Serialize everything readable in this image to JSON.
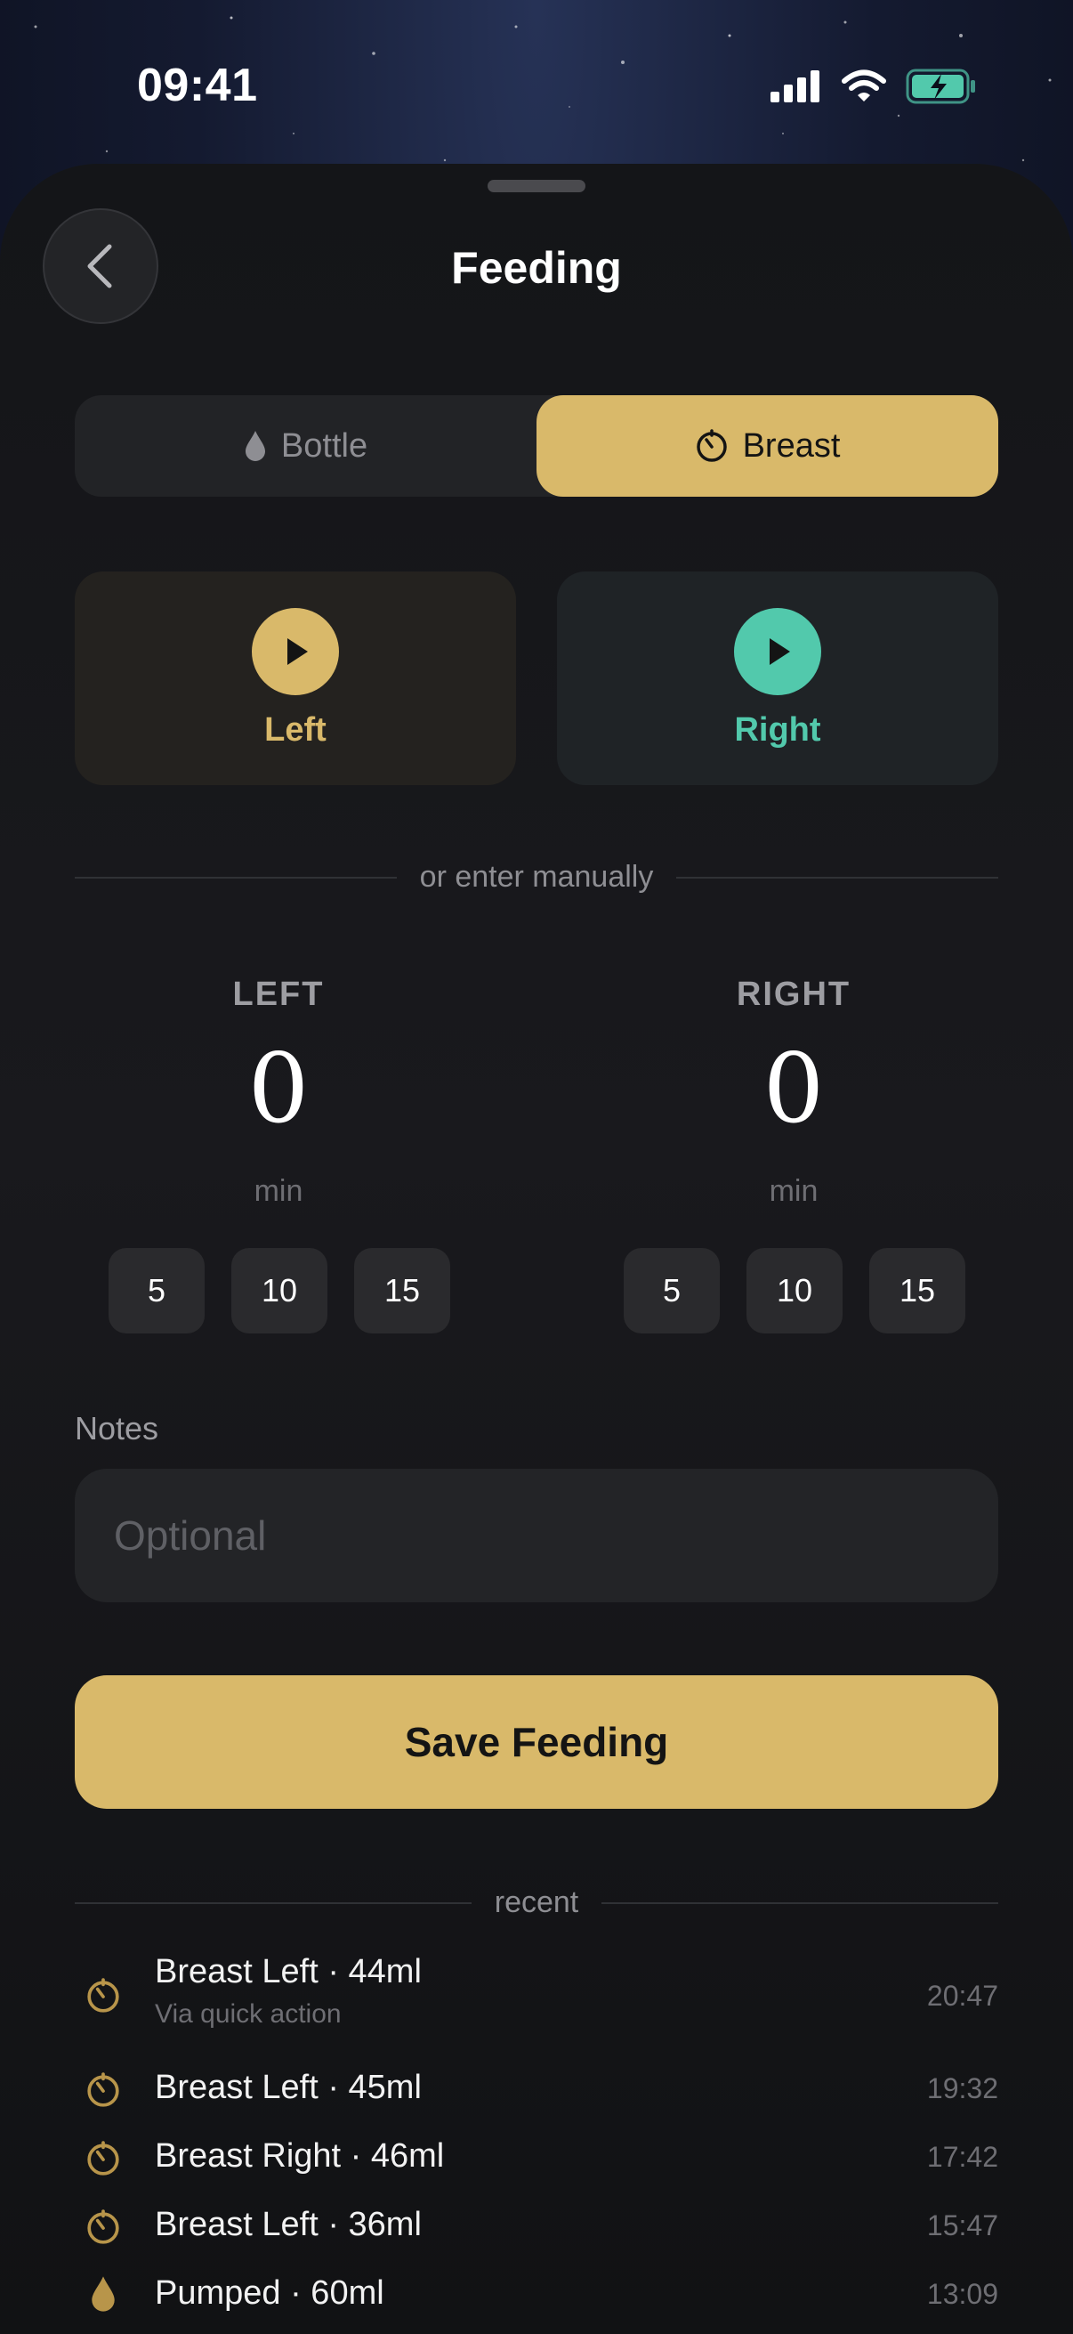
{
  "status_bar": {
    "time": "09:41"
  },
  "header": {
    "title": "Feeding"
  },
  "segment": {
    "options": [
      {
        "label": "Bottle",
        "icon": "drop-icon",
        "selected": false
      },
      {
        "label": "Breast",
        "icon": "timer-icon",
        "selected": true
      }
    ]
  },
  "timers": {
    "left_label": "Left",
    "right_label": "Right"
  },
  "manual": {
    "divider_text": "or enter manually",
    "left": {
      "heading": "LEFT",
      "value": "0",
      "unit": "min",
      "presets": [
        "5",
        "10",
        "15"
      ]
    },
    "right": {
      "heading": "RIGHT",
      "value": "0",
      "unit": "min",
      "presets": [
        "5",
        "10",
        "15"
      ]
    }
  },
  "notes": {
    "label": "Notes",
    "placeholder": "Optional"
  },
  "save_label": "Save Feeding",
  "recent": {
    "heading": "recent",
    "items": [
      {
        "title": "Breast Left · 44ml",
        "subtitle": "Via quick action",
        "time": "20:47",
        "icon": "timer-icon"
      },
      {
        "title": "Breast Left · 45ml",
        "time": "19:32",
        "icon": "timer-icon"
      },
      {
        "title": "Breast Right · 46ml",
        "time": "17:42",
        "icon": "timer-icon"
      },
      {
        "title": "Breast Left · 36ml",
        "time": "15:47",
        "icon": "timer-icon"
      },
      {
        "title": "Pumped · 60ml",
        "time": "13:09",
        "icon": "drop-icon"
      }
    ]
  },
  "colors": {
    "accent_gold": "#d9b96a",
    "accent_teal": "#52c9ac",
    "battery": "#52c9ac"
  }
}
